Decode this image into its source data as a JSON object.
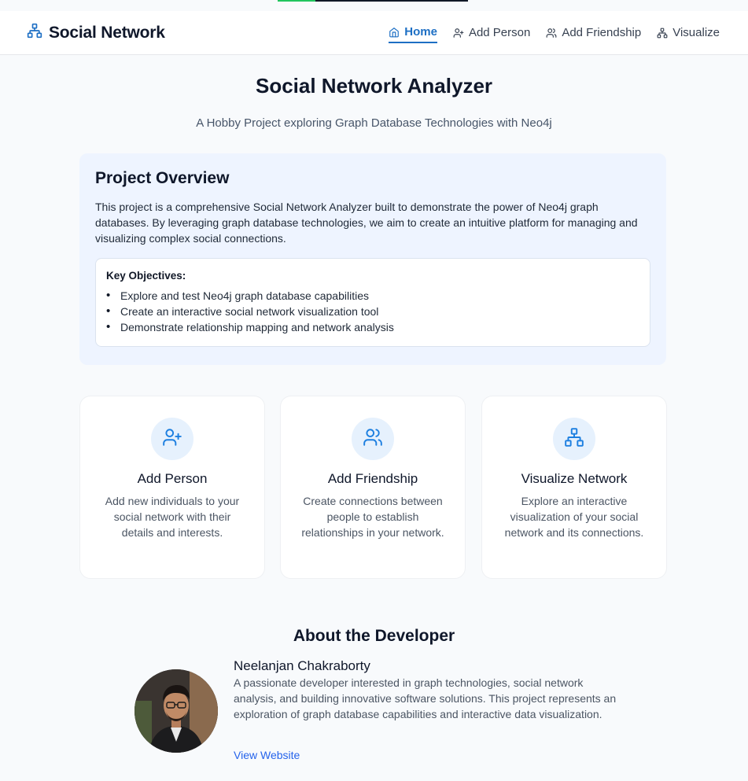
{
  "colors": {
    "accent": "#1d6fc4",
    "page_bg": "#f8fafc",
    "overview_bg": "#eef4ff",
    "icon_circle": "#e6f1fd",
    "link": "#2563eb"
  },
  "header": {
    "brand_icon": "network-icon",
    "brand": "Social Network",
    "nav": [
      {
        "label": "Home",
        "icon": "home-icon",
        "active": true
      },
      {
        "label": "Add Person",
        "icon": "user-plus-icon",
        "active": false
      },
      {
        "label": "Add Friendship",
        "icon": "users-icon",
        "active": false
      },
      {
        "label": "Visualize",
        "icon": "network-icon",
        "active": false
      }
    ]
  },
  "hero": {
    "title": "Social Network Analyzer",
    "subtitle": "A Hobby Project exploring Graph Database Technologies with Neo4j"
  },
  "overview": {
    "title": "Project Overview",
    "text": "This project is a comprehensive Social Network Analyzer built to demonstrate the power of Neo4j graph databases. By leveraging graph database technologies, we aim to create an intuitive platform for managing and visualizing complex social connections.",
    "objectives_title": "Key Objectives:",
    "objectives": [
      "Explore and test Neo4j graph database capabilities",
      "Create an interactive social network visualization tool",
      "Demonstrate relationship mapping and network analysis"
    ]
  },
  "features": [
    {
      "icon": "user-plus-icon",
      "title": "Add Person",
      "description": "Add new individuals to your social network with their details and interests."
    },
    {
      "icon": "users-icon",
      "title": "Add Friendship",
      "description": "Create connections between people to establish relationships in your network."
    },
    {
      "icon": "network-icon",
      "title": "Visualize Network",
      "description": "Explore an interactive visualization of your social network and its connections."
    }
  ],
  "about": {
    "title": "About the Developer",
    "name": "Neelanjan Chakraborty",
    "bio": "A passionate developer interested in graph technologies, social network analysis, and building innovative software solutions. This project represents an exploration of graph database capabilities and interactive data visualization.",
    "link_label": "View Website"
  }
}
